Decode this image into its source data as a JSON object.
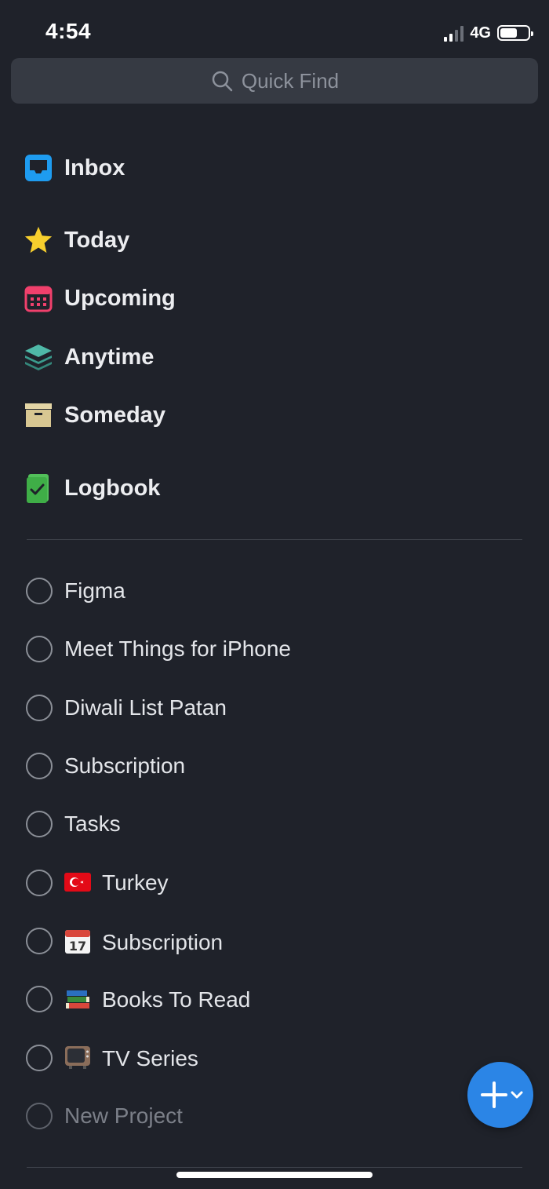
{
  "status": {
    "time": "4:54",
    "network": "4G",
    "battery_percent": 62
  },
  "search": {
    "placeholder": "Quick Find"
  },
  "nav": [
    {
      "label": "Inbox",
      "icon": "inbox-icon"
    },
    {
      "label": "Today",
      "icon": "star-icon"
    },
    {
      "label": "Upcoming",
      "icon": "calendar-icon"
    },
    {
      "label": "Anytime",
      "icon": "layers-icon"
    },
    {
      "label": "Someday",
      "icon": "archive-box-icon"
    },
    {
      "label": "Logbook",
      "icon": "logbook-icon"
    }
  ],
  "projects": [
    {
      "label": "Figma"
    },
    {
      "label": "Meet Things for iPhone"
    },
    {
      "label": "Diwali List Patan"
    },
    {
      "label": "Subscription"
    },
    {
      "label": "Tasks"
    },
    {
      "label": "Turkey",
      "emoji": "turkey-flag-icon"
    },
    {
      "label": "Subscription",
      "emoji": "calendar-17-icon"
    },
    {
      "label": "Books To Read",
      "emoji": "books-icon"
    },
    {
      "label": "TV Series",
      "emoji": "television-icon"
    }
  ],
  "new_project": {
    "label": "New Project"
  },
  "colors": {
    "accent": "#2b85e6",
    "background": "#1f222a"
  }
}
